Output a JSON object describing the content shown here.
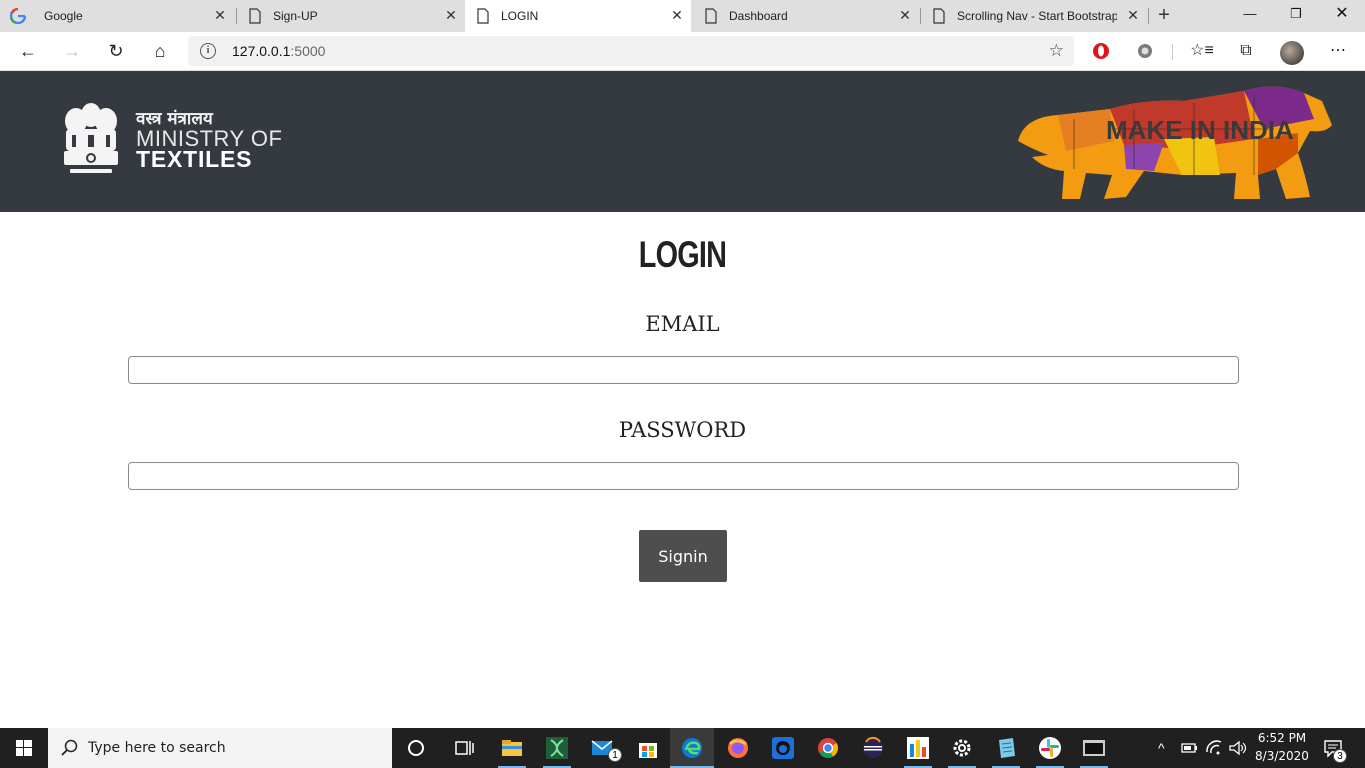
{
  "browser": {
    "tabs": [
      {
        "title": "Google",
        "icon": "google-icon",
        "active": false
      },
      {
        "title": "Sign-UP",
        "icon": "page-icon",
        "active": false
      },
      {
        "title": "LOGIN",
        "icon": "page-icon",
        "active": true
      },
      {
        "title": "Dashboard",
        "icon": "page-icon",
        "active": false
      },
      {
        "title": "Scrolling Nav - Start Bootstrap",
        "icon": "page-icon",
        "active": false
      }
    ],
    "url_host": "127.0.0.1",
    "url_port": ":5000"
  },
  "header": {
    "ministry_hindi": "वस्त्र मंत्रालय",
    "ministry_line1": "MINISTRY OF",
    "ministry_line2": "TEXTILES",
    "make_in_india": "MAKE IN INDIA",
    "background_color": "#343a40"
  },
  "form": {
    "title": "LOGIN",
    "email_label": "EMAIL",
    "email_value": "",
    "password_label": "PASSWORD",
    "password_value": "",
    "submit_label": "Signin"
  },
  "taskbar": {
    "search_placeholder": "Type here to search",
    "mail_badge": "1",
    "time": "6:52 PM",
    "date": "8/3/2020",
    "notification_count": "3",
    "accent_color": "#76b9ed"
  }
}
